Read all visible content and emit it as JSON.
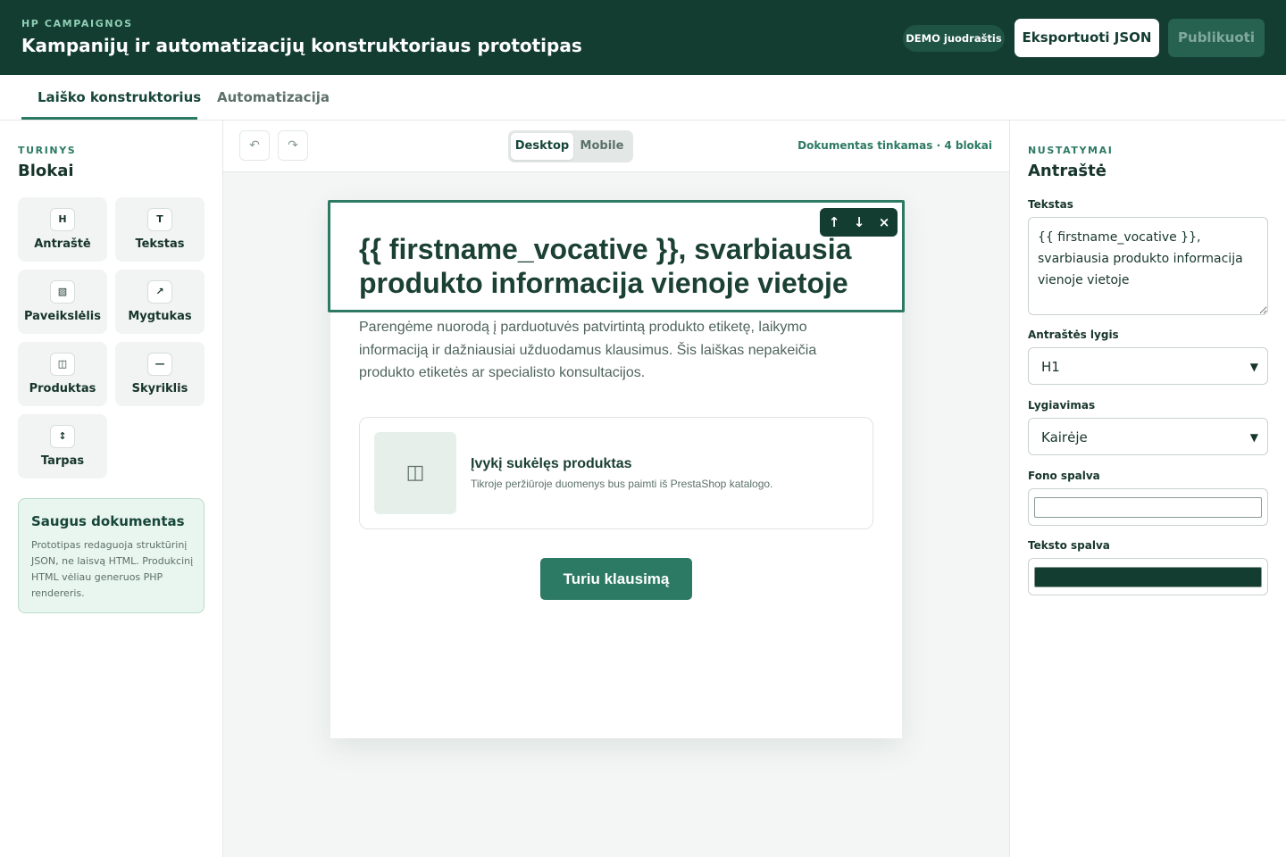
{
  "header": {
    "brand": "HP CAMPAIGNOS",
    "title": "Kampanijų ir automatizacijų konstruktoriaus prototipas",
    "badge": "DEMO juodraštis",
    "export_label": "Eksportuoti JSON",
    "publish_label": "Publikuoti"
  },
  "tabs": [
    {
      "label": "Laiško konstruktorius",
      "active": true
    },
    {
      "label": "Automatizacija",
      "active": false
    }
  ],
  "left": {
    "kicker": "TURINYS",
    "title": "Blokai",
    "blocks": [
      {
        "label": "Antraštė",
        "icon": "H"
      },
      {
        "label": "Tekstas",
        "icon": "T"
      },
      {
        "label": "Paveikslėlis",
        "icon": "▧"
      },
      {
        "label": "Mygtukas",
        "icon": "↗"
      },
      {
        "label": "Produktas",
        "icon": "◫"
      },
      {
        "label": "Skyriklis",
        "icon": "—"
      },
      {
        "label": "Tarpas",
        "icon": "↕"
      }
    ],
    "info": {
      "title": "Saugus dokumentas",
      "text": "Prototipas redaguoja struktūrinį JSON, ne laisvą HTML. Produkcinį HTML vėliau generuos PHP rendereris."
    }
  },
  "toolbar": {
    "undo": "↶",
    "redo": "↷",
    "view_desktop": "Desktop",
    "view_mobile": "Mobile",
    "status": "Dokumentas tinkamas · 4 blokai"
  },
  "email": {
    "heading": "{{ firstname_vocative }}, svarbiausia produkto informacija vienoje vietoje",
    "block_actions": {
      "up": "↑",
      "down": "↓",
      "remove": "×"
    },
    "paragraph": "Parengėme nuorodą į parduotuvės patvirtintą produkto etiketę, laikymo informaciją ir dažniausiai užduodamus klausimus. Šis laiškas nepakeičia produkto etiketės ar specialisto konsultacijos.",
    "product": {
      "thumb_icon": "◫",
      "name": "Įvykį sukėlęs produktas",
      "description": "Tikroje peržiūroje duomenys bus paimti iš PrestaShop katalogo."
    },
    "cta": "Turiu klausimą"
  },
  "settings": {
    "kicker": "NUSTATYMAI",
    "title": "Antraštė",
    "text_label": "Tekstas",
    "text_value": "{{ firstname_vocative }}, svarbiausia produkto informacija vienoje vietoje",
    "level_label": "Antraštės lygis",
    "level_value": "H1",
    "align_label": "Lygiavimas",
    "align_value": "Kairėje",
    "bg_label": "Fono spalva",
    "bg_color": "#ffffff",
    "text_color_label": "Teksto spalva",
    "text_color": "#143d32"
  }
}
